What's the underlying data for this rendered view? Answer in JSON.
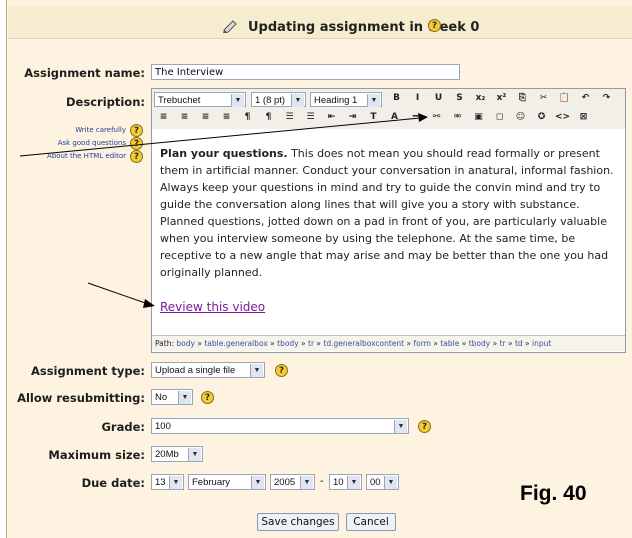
{
  "header": {
    "title": "Updating assignment in week 0"
  },
  "form": {
    "assignment_name_label": "Assignment name:",
    "assignment_name_value": "The Interview",
    "description_label": "Description:",
    "help_links": [
      "Write carefully",
      "Ask good questions",
      "About the HTML editor"
    ],
    "toolbar": {
      "font_family": "Trebuchet",
      "font_size": "1 (8 pt)",
      "heading": "Heading 1",
      "row1_buttons": [
        "B",
        "I",
        "U",
        "S",
        "x₂",
        "x²",
        "⎘",
        "✂",
        "📋",
        "↶",
        "↷"
      ],
      "row2_buttons": [
        "≡",
        "≡",
        "≡",
        "≡",
        "¶",
        "¶",
        "☰",
        "☰",
        "⇤",
        "⇥",
        "T",
        "A",
        "━",
        "⚯",
        "⚮",
        "▣",
        "◻",
        "☺",
        "✪",
        "<>",
        "⊠"
      ]
    },
    "description_heading": "Plan your questions.",
    "description_body": " This does not mean you should read formally or present them in artificial  manner.  Conduct  your  conversation  in anatural, informal fashion. Always keep your questions in mind and try to guide the convin mind and try to guide the conversation along lines that will give you a story with substance. Planned questions, jotted down on a pad in front of you, are particularly valuable  when  you  interview  someone  by using  the telephone. At the same time, be receptive to a new angle that may arise and may be better than the one you had originally planned.",
    "description_link": "Review this video",
    "path_label": "Path:",
    "path_items": [
      "body",
      "table.generalbox",
      "tbody",
      "tr",
      "td.generalboxcontent",
      "form",
      "table",
      "tbody",
      "tr",
      "td",
      "input"
    ],
    "assignment_type_label": "Assignment type:",
    "assignment_type_value": "Upload a single file",
    "allow_resubmit_label": "Allow resubmitting:",
    "allow_resubmit_value": "No",
    "grade_label": "Grade:",
    "grade_value": "100",
    "max_size_label": "Maximum size:",
    "max_size_value": "20Mb",
    "due_date_label": "Due date:",
    "due_day": "13",
    "due_month": "February",
    "due_year": "2005",
    "due_sep": "-",
    "due_hour": "10",
    "due_minute": "00",
    "save_button": "Save changes",
    "cancel_button": "Cancel"
  },
  "figure_label": "Fig. 40",
  "colors": {
    "panel": "#fdf3e0",
    "header": "#f6eccf",
    "help": "#f0cc3a",
    "link": "#7c1b9a"
  }
}
